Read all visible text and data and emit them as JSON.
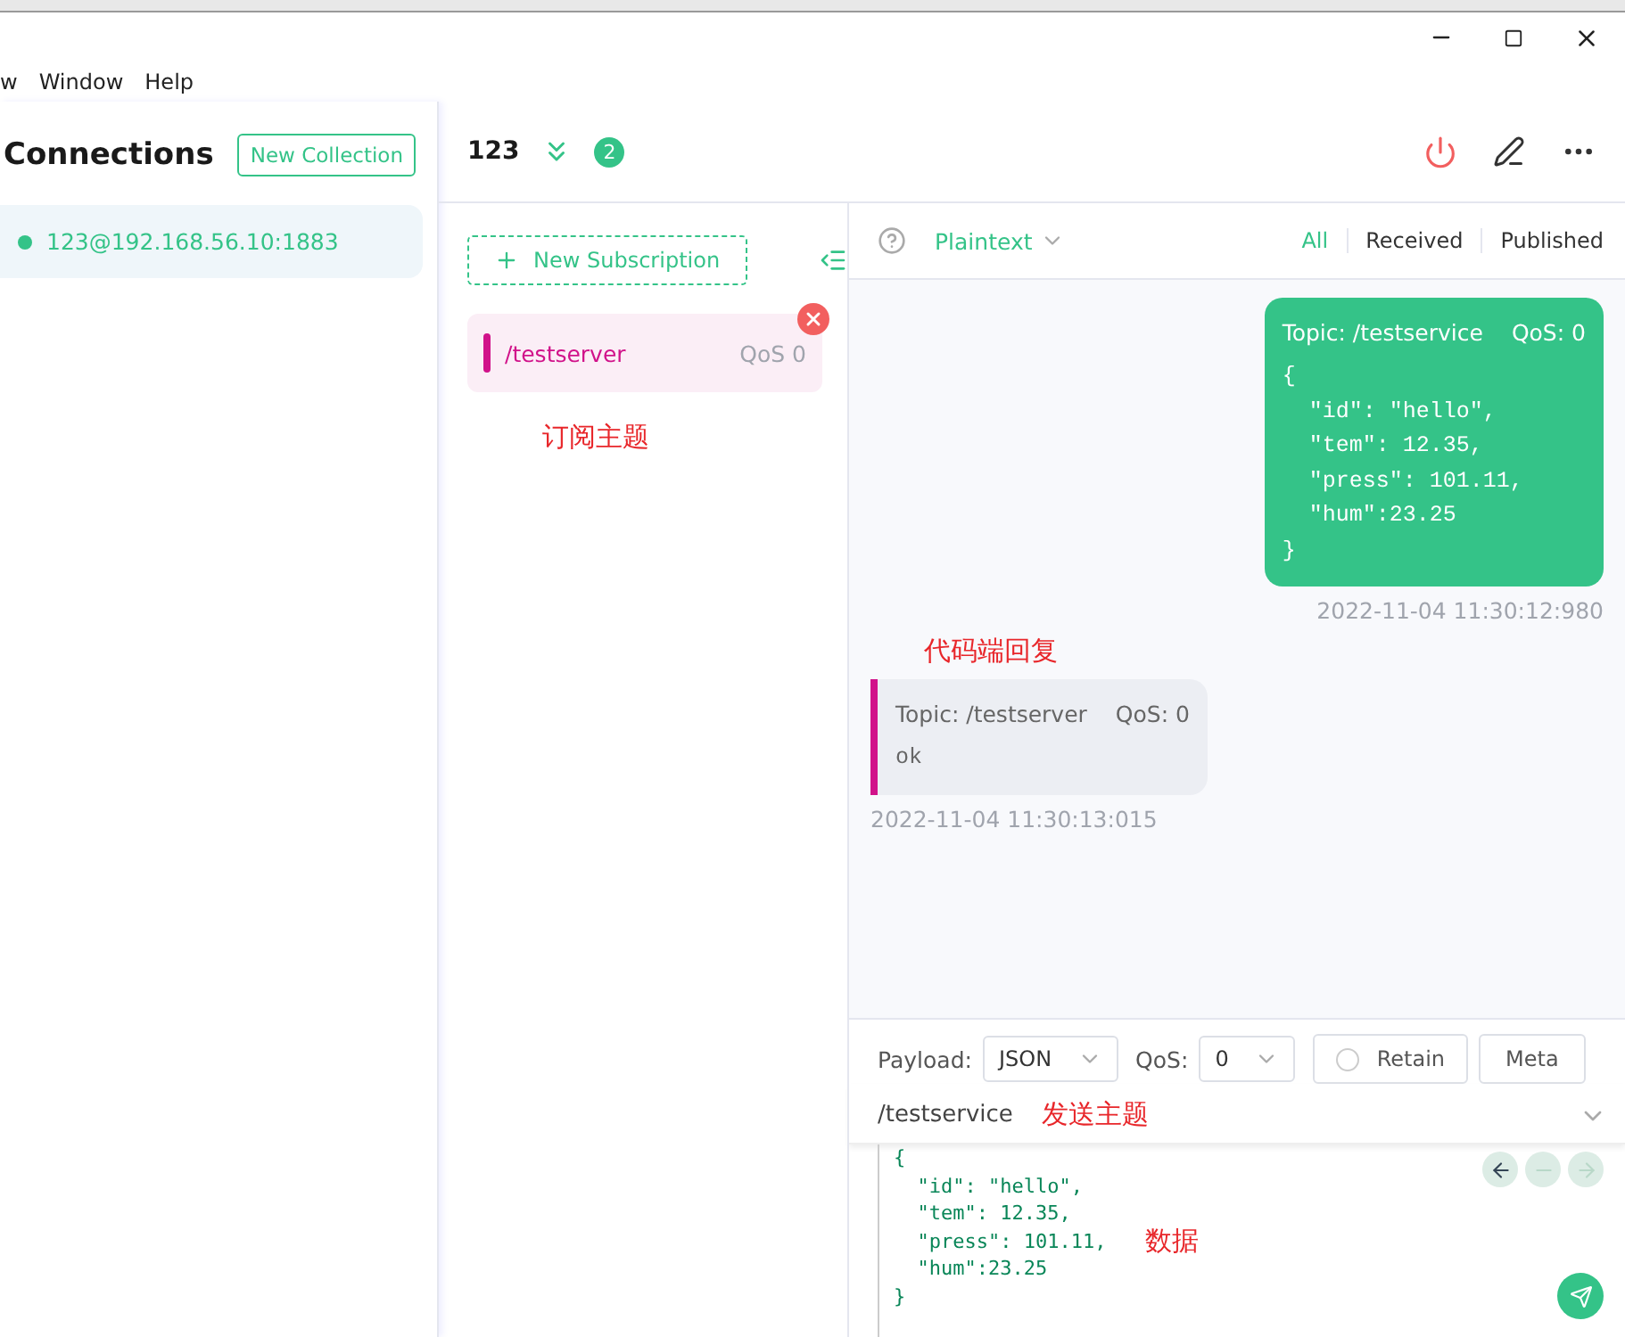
{
  "menu": [
    "w",
    "Window",
    "Help"
  ],
  "sidebar": {
    "title": "Connections",
    "new_button": "New Collection",
    "connections": [
      {
        "name": "123@192.168.56.10:1883",
        "selected": true,
        "color": "#34c388"
      }
    ]
  },
  "header": {
    "name": "123",
    "badge": "2"
  },
  "subscriptions": {
    "new_button": "New Subscription",
    "items": [
      {
        "topic": "/testserver",
        "qos": "QoS 0",
        "color": "#d1128a",
        "selected": true
      }
    ],
    "annotation": "订阅主题"
  },
  "toolbar": {
    "format": "Plaintext",
    "filters": [
      {
        "label": "All",
        "selected": true
      },
      {
        "label": "Received",
        "selected": false
      },
      {
        "label": "Published",
        "selected": false
      }
    ]
  },
  "messages": [
    {
      "kind": "sent",
      "topic": "Topic: /testservice",
      "qos": "QoS: 0",
      "lines": [
        "{",
        "  \"id\": \"hello\",",
        "  \"tem\": 12.35,",
        "  \"press\": 101.11,",
        "  \"hum\":23.25",
        "}"
      ],
      "time": "2022-11-04 11:30:12:980"
    },
    {
      "kind": "received",
      "annotation": "代码端回复",
      "topic": "Topic: /testserver",
      "qos": "QoS: 0",
      "lines": [
        "ok"
      ],
      "time": "2022-11-04 11:30:13:015",
      "color": "#d1128a"
    }
  ],
  "publish": {
    "payload_label": "Payload:",
    "payload": "JSON",
    "qos_label": "QoS:",
    "qos": "0",
    "retain": {
      "label": "Retain",
      "checked": false
    },
    "meta": "Meta",
    "topic": "/testservice",
    "topic_annotation": "发送主题",
    "lines": [
      "{",
      "  \"id\": \"hello\",",
      "  \"tem\": 12.35,",
      "  \"press\": 101.11,",
      "  \"hum\":23.25",
      "}"
    ],
    "data_annotation": "数据"
  }
}
